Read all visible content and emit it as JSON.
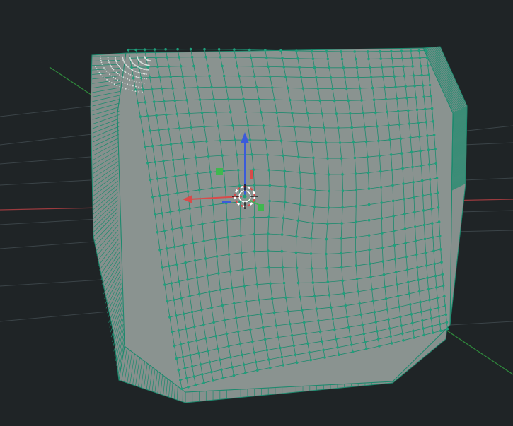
{
  "viewport": {
    "background": "#1f2426",
    "grid_color": "#3b4448",
    "x_axis_color": "#9a3a3e",
    "y_axis_color": "#2f8a3c"
  },
  "mesh": {
    "object_type": "subdivided cube",
    "selection_mode": "vertex",
    "face_color": "#8a9390",
    "face_shadow_color": "#7d8784",
    "side_color": "#86908d",
    "wire_color": "#1d8a6e",
    "vertex_color": "#1fa07c",
    "pole_color": "#d9dfdc"
  },
  "gizmo": {
    "mode": "move",
    "x_color": "#d94a4a",
    "y_color": "#3fb84f",
    "z_color": "#3b5bdb",
    "pivot_icon": "3d-cursor-icon"
  }
}
